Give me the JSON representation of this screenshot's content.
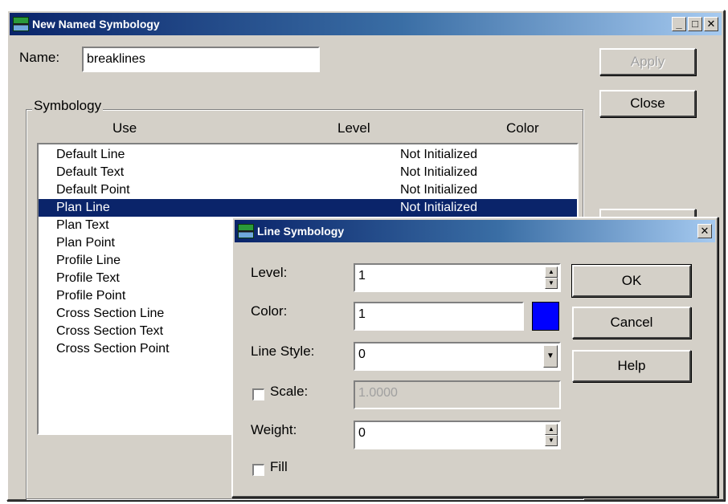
{
  "main_window": {
    "title": "New Named Symbology",
    "name_label": "Name:",
    "name_value": "breaklines",
    "apply_label": "Apply",
    "close_label": "Close",
    "group_label": "Symbology",
    "columns": [
      "Use",
      "Level",
      "Color"
    ],
    "rows": [
      {
        "use": "Default Line",
        "level": "Not Initialized"
      },
      {
        "use": "Default Text",
        "level": "Not Initialized"
      },
      {
        "use": "Default Point",
        "level": "Not Initialized"
      },
      {
        "use": "Plan Line",
        "level": "Not Initialized"
      },
      {
        "use": "Plan Text",
        "level": ""
      },
      {
        "use": "Plan Point",
        "level": ""
      },
      {
        "use": "Profile Line",
        "level": ""
      },
      {
        "use": "Profile Text",
        "level": ""
      },
      {
        "use": "Profile Point",
        "level": ""
      },
      {
        "use": "Cross Section Line",
        "level": ""
      },
      {
        "use": "Cross Section Text",
        "level": ""
      },
      {
        "use": "Cross Section Point",
        "level": ""
      }
    ],
    "selected_row": "Plan Line"
  },
  "dialog": {
    "title": "Line Symbology",
    "level_label": "Level:",
    "level_value": "1",
    "color_label": "Color:",
    "color_value": "1",
    "color_swatch": "#0000ff",
    "line_style_label": "Line Style:",
    "line_style_value": "0",
    "scale_label": "Scale:",
    "scale_value": "1.0000",
    "weight_label": "Weight:",
    "weight_value": "0",
    "fill_label": "Fill",
    "ok_label": "OK",
    "cancel_label": "Cancel",
    "help_label": "Help"
  }
}
